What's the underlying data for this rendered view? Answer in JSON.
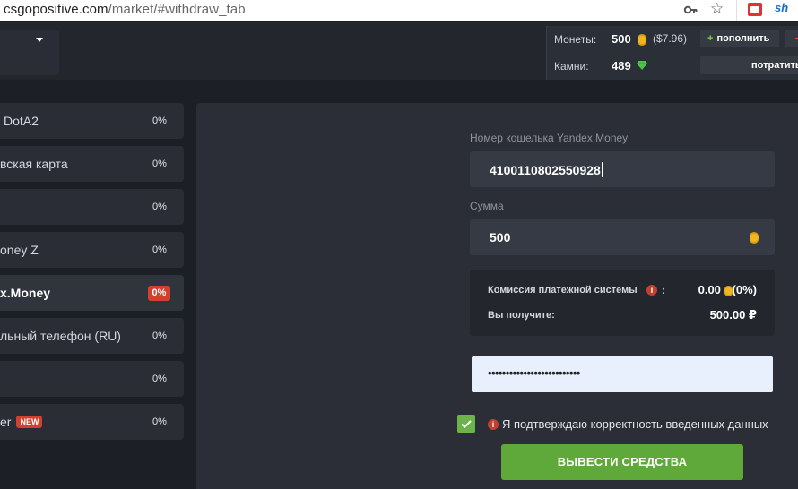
{
  "browser": {
    "url_domain": "csgopositive.com",
    "url_path": "/market/#withdraw_tab"
  },
  "header": {
    "coins_label": "Монеты:",
    "coins_value": "500",
    "coins_usd": "($7.96)",
    "topup_label": "пополнить",
    "gems_label": "Камни:",
    "gems_value": "489",
    "spend_label": "потратить"
  },
  "methods": [
    {
      "label": "DotA2",
      "pct": "0%",
      "label_left": 4
    },
    {
      "label": "вская карта",
      "pct": "0%",
      "label_left": 0
    },
    {
      "label": "",
      "pct": "0%",
      "label_left": 0
    },
    {
      "label": "oney Z",
      "pct": "0%",
      "label_left": 0
    },
    {
      "label": "x.Money",
      "pct": "0%",
      "active": true
    },
    {
      "label": "льный телефон (RU)",
      "pct": "0%"
    },
    {
      "label": "",
      "pct": "0%"
    },
    {
      "label": "er",
      "pct": "0%",
      "badge": "NEW"
    }
  ],
  "form": {
    "wallet_label": "Номер кошелька Yandex.Money",
    "wallet_value": "410011080255092​8",
    "amount_label": "Сумма",
    "amount_value": "500",
    "fee_label": "Комиссия платежной системы",
    "fee_colon": ":",
    "fee_value": "0.00",
    "fee_pct": "(0%)",
    "receive_label": "Вы получите:",
    "receive_value": "500.00 ₽",
    "password_value": "••••••••••••••••••••••••••",
    "confirm_text": "Я подтверждаю корректность введенных данных",
    "submit_label": "ВЫВЕСТИ СРЕДСТВА",
    "info_glyph": "i"
  },
  "colors": {
    "accent_green": "#5fa93b",
    "badge_red": "#d2412f",
    "coin_gold": "#f2b623",
    "gem_green": "#4cc34a"
  }
}
